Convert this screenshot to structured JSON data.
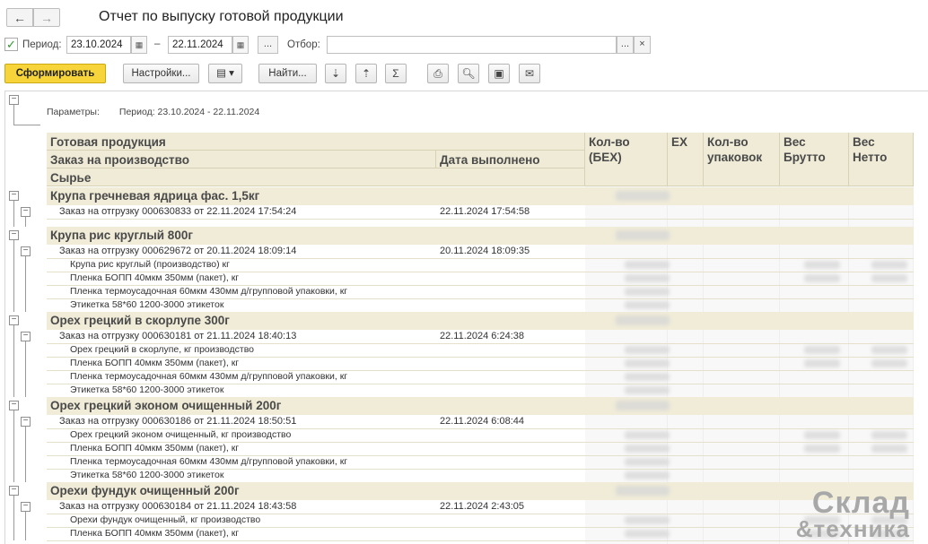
{
  "window": {
    "title": "Отчет по выпуску готовой продукции",
    "back_icon": "←",
    "forward_icon": "→"
  },
  "period": {
    "checkbox_mark": "✓",
    "label": "Период:",
    "date_from": "23.10.2024",
    "dash": "–",
    "date_to": "22.11.2024",
    "ellipsis": "...",
    "filter_label": "Отбор:",
    "filter_value": "",
    "filter_ellipsis": "...",
    "filter_clear": "×"
  },
  "toolbar": {
    "generate": "Сформировать",
    "settings": "Настройки...",
    "find": "Найти..."
  },
  "params": {
    "label": "Параметры:",
    "value": "Период: 23.10.2024 - 22.11.2024"
  },
  "headers": {
    "product": "Готовая продукция",
    "order": "Заказ на производство",
    "date_done": "Дата выполнено",
    "material": "Сырье",
    "qty_bex": "Кол-во (БЕХ)",
    "ex": "ЕХ",
    "qty_pack": "Кол-во упаковок",
    "gross": "Вес Брутто",
    "net": "Вес Нетто"
  },
  "groups": [
    {
      "name": "Крупа гречневая ядрица фас. 1,5кг",
      "order": "Заказ на отгрузку 000630833 от 22.11.2024 17:54:24",
      "date": "22.11.2024 17:54:58",
      "items": []
    },
    {
      "name": "Крупа рис круглый 800г",
      "order": "Заказ на отгрузку 000629672 от 20.11.2024 18:09:14",
      "date": "20.11.2024 18:09:35",
      "items": [
        "Крупа рис круглый (производство) кг",
        "Пленка БОПП 40мкм 350мм (пакет), кг",
        "Пленка термоусадочная 60мкм 430мм д/групповой упаковки, кг",
        "Этикетка 58*60 1200-3000 этикеток"
      ]
    },
    {
      "name": "Орех грецкий в скорлупе 300г",
      "order": "Заказ на отгрузку 000630181 от 21.11.2024 18:40:13",
      "date": "22.11.2024 6:24:38",
      "items": [
        "Орех грецкий в скорлупе, кг производство",
        "Пленка БОПП 40мкм 350мм (пакет), кг",
        "Пленка термоусадочная 60мкм 430мм д/групповой упаковки, кг",
        "Этикетка 58*60 1200-3000 этикеток"
      ]
    },
    {
      "name": "Орех грецкий эконом очищенный 200г",
      "order": "Заказ на отгрузку 000630186 от 21.11.2024 18:50:51",
      "date": "22.11.2024 6:08:44",
      "items": [
        "Орех грецкий эконом очищенный, кг производство",
        "Пленка БОПП 40мкм 350мм (пакет), кг",
        "Пленка термоусадочная 60мкм 430мм д/групповой упаковки, кг",
        "Этикетка 58*60 1200-3000 этикеток"
      ]
    },
    {
      "name": "Орехи фундук очищенный 200г",
      "order": "Заказ на отгрузку 000630184 от 21.11.2024 18:43:58",
      "date": "22.11.2024 2:43:05",
      "items": [
        "Орехи фундук очищенный, кг производство",
        "Пленка БОПП 40мкм 350мм (пакет), кг"
      ]
    }
  ],
  "watermark": {
    "line1": "Склад",
    "line2": "&техника"
  }
}
